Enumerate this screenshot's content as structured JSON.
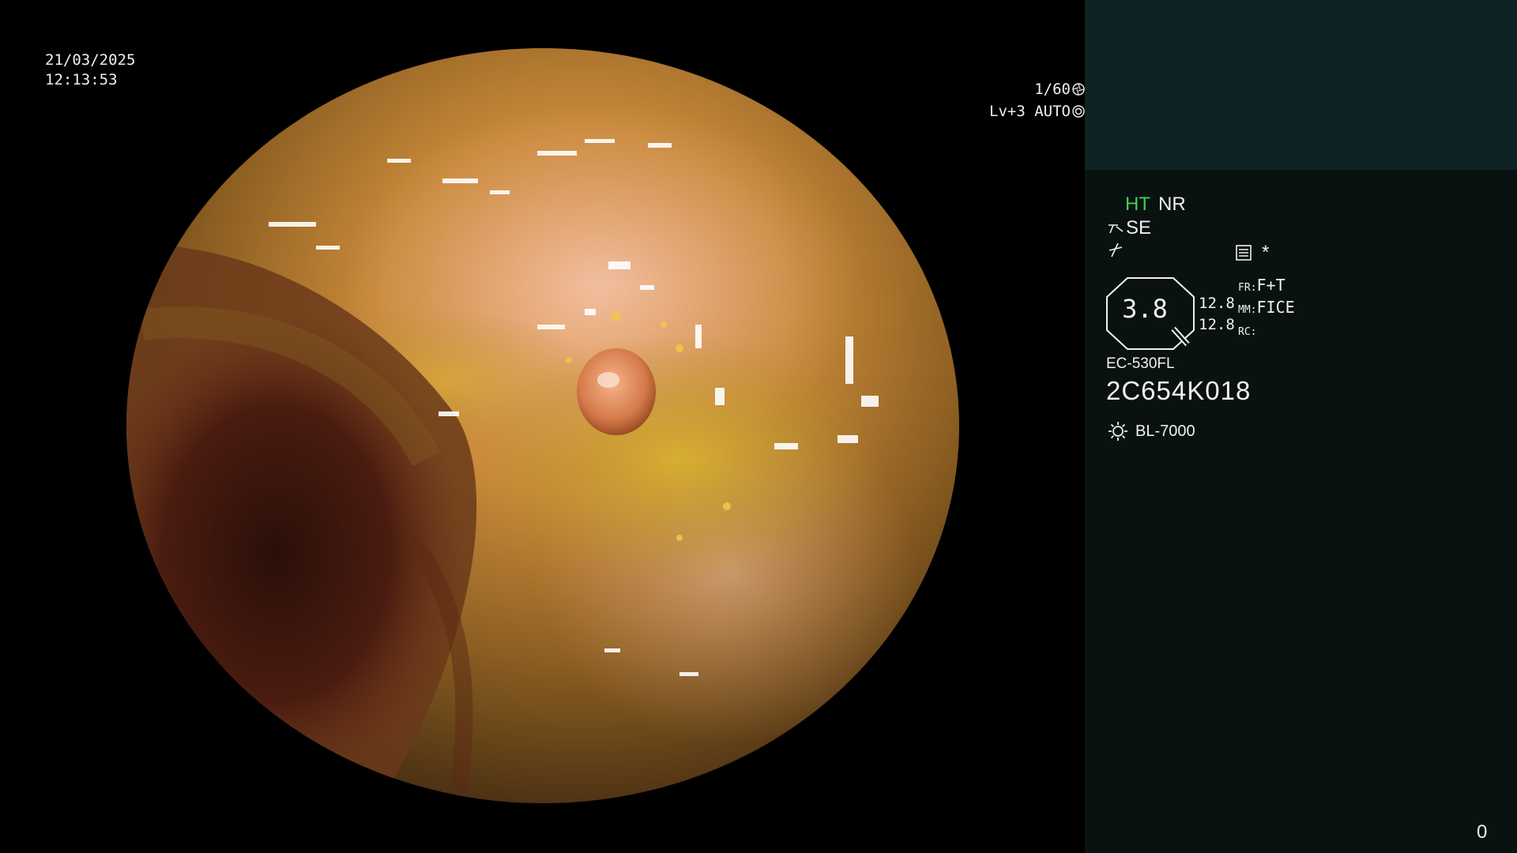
{
  "osd": {
    "date": "21/03/2025",
    "time": "12:13:53",
    "shutter": "1/60",
    "shutter_icon": "aperture-icon",
    "iris": "Lv+3 AUTO",
    "iris_icon": "iris-icon"
  },
  "info": {
    "ht": "HT",
    "nr": "NR",
    "se": "SE",
    "se_icon": "structure-enhance-icon",
    "bolt_icon": "color-mode-icon",
    "memo_icon": "memo-icon",
    "star": "*",
    "zoom_value": "3.8",
    "zoom_line1": "12.8",
    "zoom_line2": "12.8",
    "fr_label": "FR:",
    "fr_value": "F+T",
    "mm_label": "MM:",
    "mm_value": "FICE",
    "rc_label": "RC:",
    "rc_value": "",
    "scope_model": "EC-530FL",
    "scope_serial": "2C654K018",
    "light_source": "BL-7000",
    "light_icon": "sun-icon",
    "frame_count": "0"
  },
  "colors": {
    "panel_bg": "#0a1111",
    "panel_top_bg": "#0d2324",
    "ht_green": "#3fd24a"
  }
}
